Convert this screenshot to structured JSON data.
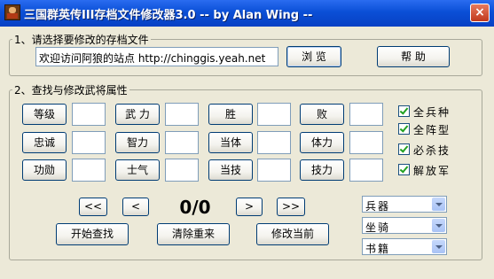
{
  "window": {
    "title": "三国群英传III存档文件修改器3.0 -- by Alan Wing --",
    "close_glyph": "×"
  },
  "file_section": {
    "label": "1、请选择要修改的存档文件",
    "path_value": "欢迎访问阿狼的站点 http://chinggis.yeah.net",
    "browse_label": "浏 览",
    "help_label": "帮 助"
  },
  "attr_section": {
    "label": "2、查找与修改武将属性",
    "attributes": [
      "等级",
      "武 力",
      "胜",
      "败",
      "忠诚",
      "智力",
      "当体",
      "体力",
      "功勋",
      "士气",
      "当技",
      "技力"
    ],
    "checkboxes": [
      {
        "label": "全兵种",
        "checked": true
      },
      {
        "label": "全阵型",
        "checked": true
      },
      {
        "label": "必杀技",
        "checked": true
      },
      {
        "label": "解放军",
        "checked": true
      }
    ]
  },
  "navigation": {
    "first_label": "<<",
    "prev_label": "<",
    "counter": "0/0",
    "next_label": ">",
    "last_label": ">>"
  },
  "actions": {
    "search_label": "开始查找",
    "clear_label": "清除重来",
    "modify_label": "修改当前"
  },
  "dropdowns": [
    {
      "value": "兵器"
    },
    {
      "value": "坐骑"
    },
    {
      "value": "书籍"
    }
  ]
}
